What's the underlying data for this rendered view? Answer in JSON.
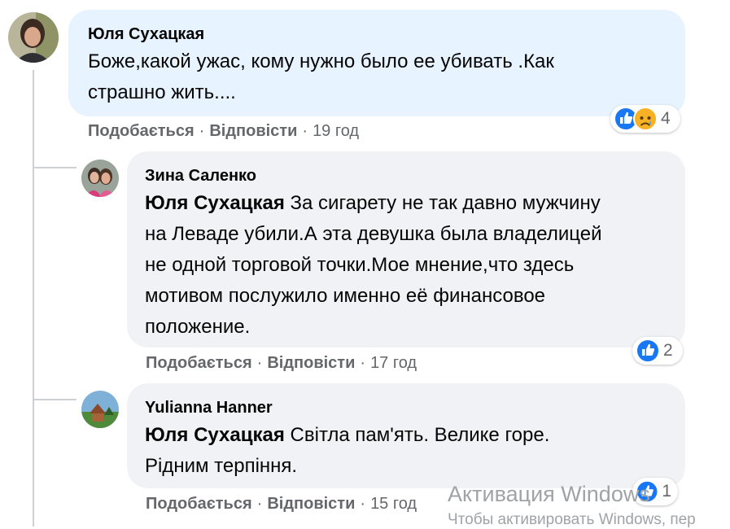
{
  "actions": {
    "like": "Подобається",
    "reply": "Відповісти",
    "dot": "·"
  },
  "comment": {
    "author": "Юля Сухацкая",
    "text_line1": "Боже,какой ужас, кому нужно было ее убивать .Как",
    "text_line2": "страшно жить....",
    "time": "19 год",
    "reaction_count": "4",
    "reactions": [
      "like-icon",
      "sad-icon"
    ]
  },
  "replies": [
    {
      "author": "Зина Саленко",
      "mention": "Юля Сухацкая",
      "line1": "За сигарету не так давно мужчину",
      "line2": "на Леваде убили.А эта девушка была владелицей",
      "line3": "не одной торговой точки.Мое мнение,что здесь",
      "line4": "мотивом послужило именно её финансовое",
      "line5": "положение.",
      "time": "17 год",
      "reaction_count": "2"
    },
    {
      "author": "Yulianna Hanner",
      "mention": "Юля Сухацкая",
      "line1": "Світла пам'ять. Велике горе.",
      "line2": "Рідним терпіння.",
      "time": "15 год",
      "reaction_count": "1"
    }
  ],
  "watermark": {
    "title": "Активация Windows",
    "subtitle": "Чтобы активировать Windows, пер"
  },
  "colors": {
    "like_blue": "#1877f2",
    "sad_yellow": "#f7b125",
    "bubble_main": "#e7f3ff",
    "bubble_reply": "#f0f2f5"
  }
}
